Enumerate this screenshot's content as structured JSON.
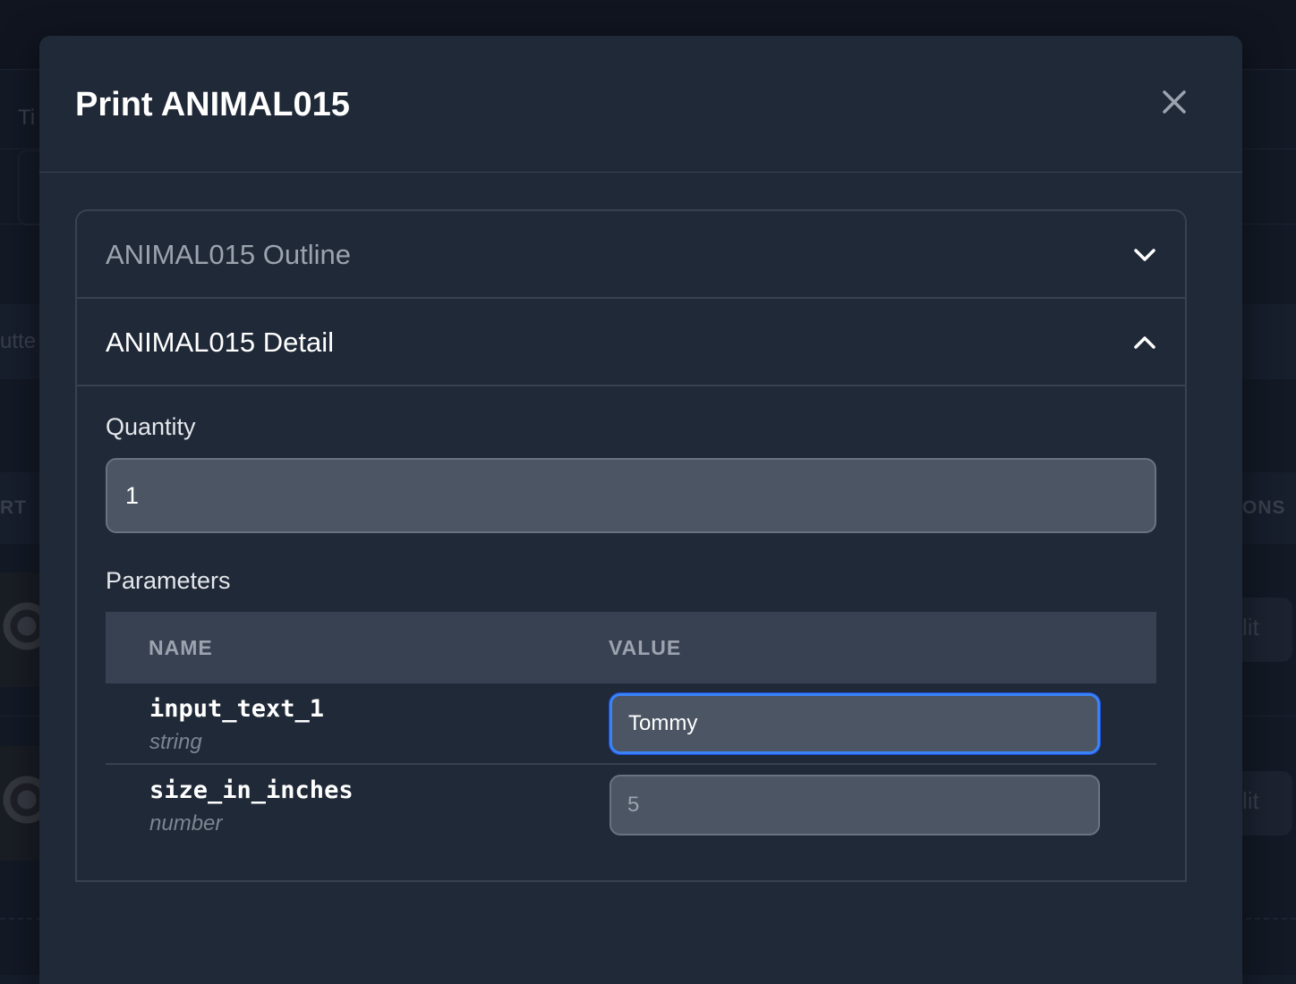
{
  "background": {
    "field_label": "Ti",
    "tab_fragment": "utte",
    "col_left_fragment": "RT",
    "col_right_fragment": "ONS",
    "row_buttons": [
      "lit",
      "lit"
    ]
  },
  "modal": {
    "title": "Print ANIMAL015",
    "close_icon": "close-icon",
    "sections": [
      {
        "label": "ANIMAL015 Outline",
        "state": "collapsed",
        "icon": "chevron-down-icon"
      },
      {
        "label": "ANIMAL015 Detail",
        "state": "expanded",
        "icon": "chevron-up-icon"
      }
    ],
    "detail": {
      "quantity_label": "Quantity",
      "quantity_value": "1",
      "parameters_label": "Parameters",
      "table": {
        "columns": [
          "NAME",
          "VALUE"
        ],
        "rows": [
          {
            "name": "input_text_1",
            "type": "string",
            "value": "Tommy"
          },
          {
            "name": "size_in_inches",
            "type": "number",
            "value": "5"
          }
        ]
      }
    }
  },
  "colors": {
    "modal_bg": "#1f2937",
    "border": "#374151",
    "input_bg": "#4b5563",
    "focus_ring": "#3b82f6"
  }
}
